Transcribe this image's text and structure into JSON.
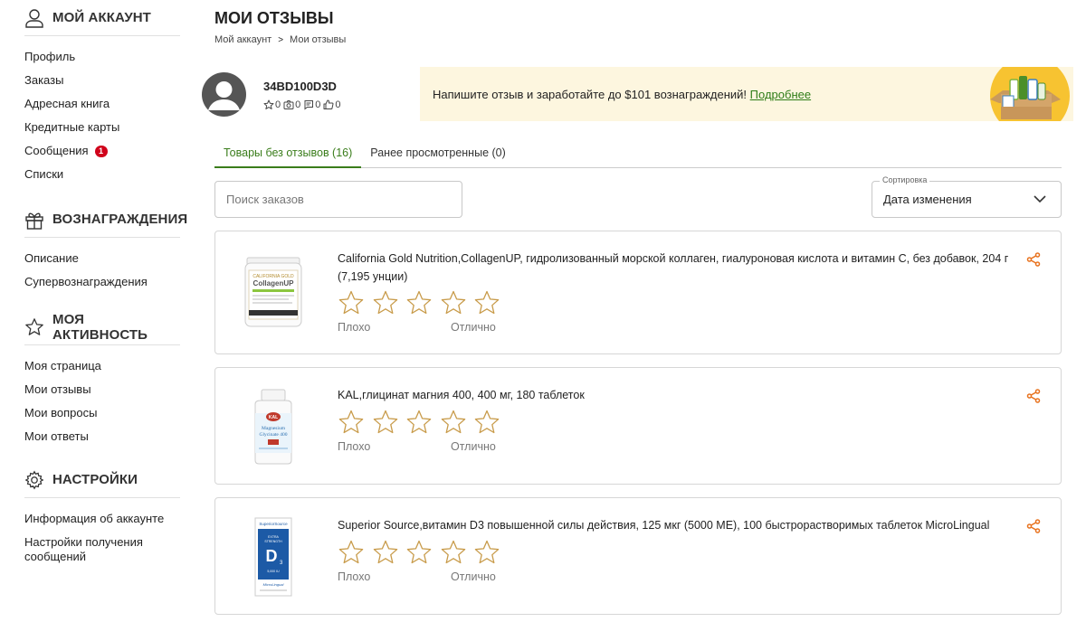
{
  "sidebar": {
    "account": {
      "title": "МОЙ АККАУНТ",
      "icon": "user-icon",
      "items": [
        {
          "label": "Профиль"
        },
        {
          "label": "Заказы"
        },
        {
          "label": "Адресная книга"
        },
        {
          "label": "Кредитные карты"
        },
        {
          "label": "Сообщения",
          "badge": "1"
        },
        {
          "label": "Списки"
        }
      ]
    },
    "rewards": {
      "title": "ВОЗНАГРАЖДЕНИЯ",
      "icon": "gift-icon",
      "items": [
        {
          "label": "Описание"
        },
        {
          "label": "Супервознаграждения"
        }
      ]
    },
    "activity": {
      "title": "МОЯ АКТИВНОСТЬ",
      "icon": "star-outline-icon",
      "items": [
        {
          "label": "Моя страница"
        },
        {
          "label": "Мои отзывы"
        },
        {
          "label": "Мои вопросы"
        },
        {
          "label": "Мои ответы"
        }
      ]
    },
    "settings": {
      "title": "НАСТРОЙКИ",
      "icon": "gear-icon",
      "items": [
        {
          "label": "Информация об аккаунте"
        },
        {
          "label": "Настройки получения сообщений"
        }
      ]
    }
  },
  "header": {
    "title": "МОИ ОТЗЫВЫ",
    "breadcrumb": [
      "Мой аккаунт",
      "Мои отзывы"
    ],
    "breadcrumb_separator": ">"
  },
  "profile": {
    "username": "34BD100D3D",
    "stats": {
      "stars": "0",
      "photos": "0",
      "comments": "0",
      "likes": "0"
    }
  },
  "promo": {
    "text": "Напишите отзыв и заработайте до $101 вознаграждений! ",
    "link": "Подробнее",
    "background": "#fdf6df"
  },
  "tabs": [
    {
      "label": "Товары без отзывов (16)",
      "active": true
    },
    {
      "label": "Ранее просмотренные (0)",
      "active": false
    }
  ],
  "search": {
    "placeholder": "Поиск заказов",
    "value": ""
  },
  "sort": {
    "label": "Сортировка",
    "value": "Дата изменения"
  },
  "rating_labels": {
    "low": "Плохо",
    "high": "Отлично"
  },
  "products": [
    {
      "name": "California Gold Nutrition,CollagenUP, гидролизованный морской коллаген, гиалуроновая кислота и витамин C, без добавок, 204 г (7,195 унции)",
      "image": "collagenup-tub-image"
    },
    {
      "name": "KAL,глицинат магния 400, 400 мг, 180 таблеток",
      "image": "kal-magnesium-bottle-image"
    },
    {
      "name": "Superior Source,витамин D3 повышенной силы действия, 125 мкг (5000 МЕ), 100 быстрорастворимых таблеток MicroLingual",
      "image": "superior-source-d3-box-image"
    }
  ],
  "colors": {
    "accent_green": "#3a7d1b",
    "share_orange": "#e8731f",
    "star_outline": "#c89b4a",
    "badge_red": "#d0021b"
  }
}
